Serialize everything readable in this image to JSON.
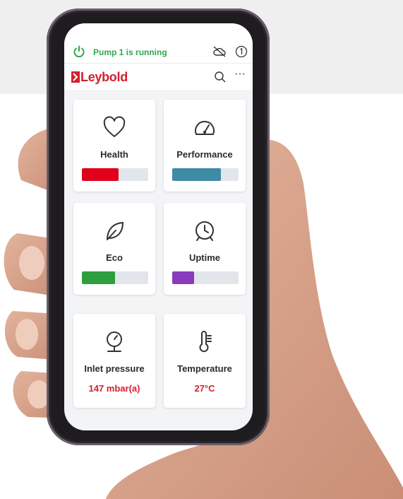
{
  "status_bar": {
    "status_text": "Pump 1 is running",
    "status_color": "#2fa84f"
  },
  "app_bar": {
    "logo_text": "Leybold",
    "brand_color": "#d3202f"
  },
  "tiles": [
    {
      "label": "Health",
      "icon": "heart-icon",
      "level": 0.55,
      "color": "#e0001b"
    },
    {
      "label": "Performance",
      "icon": "gauge-icon",
      "level": 0.73,
      "color": "#3f8ba6"
    },
    {
      "label": "Eco",
      "icon": "leaf-icon",
      "level": 0.5,
      "color": "#2e9e3f"
    },
    {
      "label": "Uptime",
      "icon": "clock-icon",
      "level": 0.33,
      "color": "#8a3bbd"
    },
    {
      "label": "Inlet pressure",
      "icon": "pressure-gauge-icon",
      "value": "147 mbar(a)"
    },
    {
      "label": "Temperature",
      "icon": "thermometer-icon",
      "value": "27°C"
    }
  ]
}
